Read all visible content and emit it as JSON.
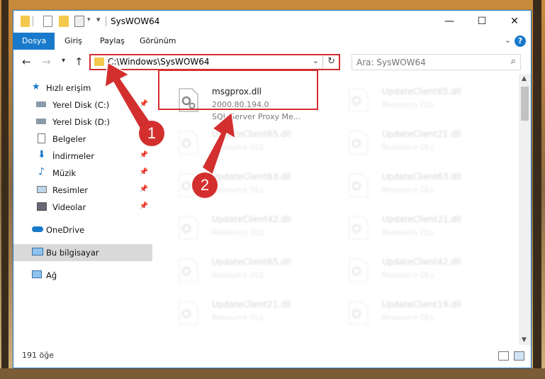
{
  "window": {
    "title": "SysWOW64",
    "controls": {
      "minimize": "—",
      "maximize": "☐",
      "close": "✕"
    }
  },
  "ribbon": {
    "tabs": [
      {
        "label": "Dosya",
        "active": true
      },
      {
        "label": "Giriş",
        "active": false
      },
      {
        "label": "Paylaş",
        "active": false
      },
      {
        "label": "Görünüm",
        "active": false
      }
    ],
    "help": "?"
  },
  "navbar": {
    "address": "C:\\Windows\\SysWOW64",
    "search_placeholder": "Ara: SysWOW64"
  },
  "sidebar": {
    "items": [
      {
        "label": "Hızlı erişim",
        "icon": "star-icon",
        "pinned": false
      },
      {
        "label": "Yerel Disk (C:)",
        "icon": "drive-icon",
        "pinned": true
      },
      {
        "label": "Yerel Disk (D:)",
        "icon": "drive-icon",
        "pinned": false
      },
      {
        "label": "Belgeler",
        "icon": "documents-icon",
        "pinned": false
      },
      {
        "label": "İndirmeler",
        "icon": "download-icon",
        "pinned": true
      },
      {
        "label": "Müzik",
        "icon": "music-icon",
        "pinned": true
      },
      {
        "label": "Resimler",
        "icon": "pictures-icon",
        "pinned": true
      },
      {
        "label": "Videolar",
        "icon": "video-icon",
        "pinned": true
      },
      {
        "label": "OneDrive",
        "icon": "cloud-icon",
        "pinned": false
      },
      {
        "label": "Bu bilgisayar",
        "icon": "computer-icon",
        "pinned": false,
        "selected": true
      },
      {
        "label": "Ağ",
        "icon": "network-icon",
        "pinned": false
      }
    ]
  },
  "files": {
    "highlighted": {
      "name": "msgprox.dll",
      "version": "2000.80.194.0",
      "description": "SQL Server Proxy Me..."
    },
    "faded": [
      {
        "name": "UpdateClient65.dll",
        "desc": "Resource DLL"
      },
      {
        "name": "UpdateClient65.dll",
        "desc": "Resource DLL"
      },
      {
        "name": "UpdateClient21.dll",
        "desc": "Resource DLL"
      },
      {
        "name": "UpdateClient63.dll",
        "desc": "Resource DLL"
      },
      {
        "name": "UpdateClient63.dll",
        "desc": "Resource DLL"
      },
      {
        "name": "UpdateClient42.dll",
        "desc": "Resource DLL"
      },
      {
        "name": "UpdateClient21.dll",
        "desc": "Resource DLL"
      },
      {
        "name": "UpdateClient65.dll",
        "desc": "Resource DLL"
      },
      {
        "name": "UpdateClient42.dll",
        "desc": "Resource DLL"
      },
      {
        "name": "UpdateClient21.dll",
        "desc": "Resource DLL"
      },
      {
        "name": "UpdateClient19.dll",
        "desc": "Resource DLL"
      }
    ]
  },
  "status": {
    "count": "191 öğe"
  },
  "callouts": {
    "one": "1",
    "two": "2"
  },
  "colors": {
    "accent": "#1979ca",
    "highlight": "#d32f2f"
  }
}
